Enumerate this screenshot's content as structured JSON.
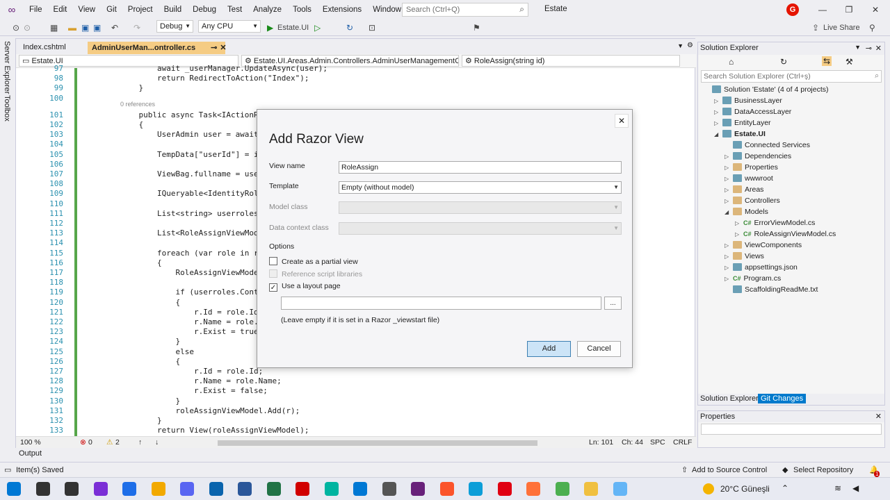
{
  "menu": {
    "items": [
      "File",
      "Edit",
      "View",
      "Git",
      "Project",
      "Build",
      "Debug",
      "Test",
      "Analyze",
      "Tools",
      "Extensions",
      "Window",
      "Help"
    ],
    "search_placeholder": "Search (Ctrl+Q)",
    "solution_name": "Estate",
    "account_initial": "G"
  },
  "toolbar": {
    "config": "Debug",
    "platform": "Any CPU",
    "startup": "Estate.UI",
    "live_share": "Live Share"
  },
  "side_tabs": {
    "server_explorer": "Server Explorer",
    "toolbox": "Toolbox"
  },
  "editor": {
    "tabs": [
      {
        "label": "Index.cshtml"
      },
      {
        "label": "AdminUserMan...ontroller.cs"
      }
    ],
    "nav": {
      "project": "Estate.UI",
      "class": "Estate.UI.Areas.Admin.Controllers.AdminUserManagementContro",
      "member": "RoleAssign(string id)"
    },
    "lines": [
      {
        "n": "97",
        "t": "        await _userManager.UpdateAsync(user);"
      },
      {
        "n": "98",
        "t": "        return RedirectToAction(\"Index\");"
      },
      {
        "n": "99",
        "t": "    }"
      },
      {
        "n": "100",
        "t": ""
      },
      {
        "n": "101",
        "t": "    public async Task<IActionResult"
      },
      {
        "n": "102",
        "t": "    {"
      },
      {
        "n": "103",
        "t": "        UserAdmin user = await _use"
      },
      {
        "n": "104",
        "t": ""
      },
      {
        "n": "105",
        "t": "        TempData[\"userId\"] = id;"
      },
      {
        "n": "106",
        "t": ""
      },
      {
        "n": "107",
        "t": "        ViewBag.fullname = user.Ful"
      },
      {
        "n": "108",
        "t": ""
      },
      {
        "n": "109",
        "t": "        IQueryable<IdentityRole> ro"
      },
      {
        "n": "110",
        "t": ""
      },
      {
        "n": "111",
        "t": "        List<string> userroles = aw"
      },
      {
        "n": "112",
        "t": ""
      },
      {
        "n": "113",
        "t": "        List<RoleAssignViewModel> r"
      },
      {
        "n": "114",
        "t": ""
      },
      {
        "n": "115",
        "t": "        foreach (var role in roles)"
      },
      {
        "n": "116",
        "t": "        {"
      },
      {
        "n": "117",
        "t": "            RoleAssignViewModel r ="
      },
      {
        "n": "118",
        "t": ""
      },
      {
        "n": "119",
        "t": "            if (userroles.Contains("
      },
      {
        "n": "120",
        "t": "            {"
      },
      {
        "n": "121",
        "t": "                r.Id = role.Id;"
      },
      {
        "n": "122",
        "t": "                r.Name = role.Name;"
      },
      {
        "n": "123",
        "t": "                r.Exist = true;"
      },
      {
        "n": "124",
        "t": "            }"
      },
      {
        "n": "125",
        "t": "            else"
      },
      {
        "n": "126",
        "t": "            {"
      },
      {
        "n": "127",
        "t": "                r.Id = role.Id;"
      },
      {
        "n": "128",
        "t": "                r.Name = role.Name;"
      },
      {
        "n": "129",
        "t": "                r.Exist = false;"
      },
      {
        "n": "130",
        "t": "            }"
      },
      {
        "n": "131",
        "t": "            roleAssignViewModel.Add(r);"
      },
      {
        "n": "132",
        "t": "        }"
      },
      {
        "n": "133",
        "t": "        return View(roleAssignViewModel);"
      }
    ],
    "references": "0 references",
    "status": {
      "zoom": "100 %",
      "errors": "0",
      "warnings": "2",
      "ln": "Ln: 101",
      "ch": "Ch: 44",
      "spc": "SPC",
      "crlf": "CRLF"
    }
  },
  "solution_explorer": {
    "title": "Solution Explorer",
    "search_placeholder": "Search Solution Explorer (Ctrl+ş)",
    "items": [
      {
        "label": "Solution 'Estate' (4 of 4 projects)",
        "indent": 0,
        "kind": "sln",
        "tw": ""
      },
      {
        "label": "BusinessLayer",
        "indent": 1,
        "kind": "proj",
        "tw": "▷"
      },
      {
        "label": "DataAccessLayer",
        "indent": 1,
        "kind": "proj",
        "tw": "▷"
      },
      {
        "label": "EntityLayer",
        "indent": 1,
        "kind": "proj",
        "tw": "▷"
      },
      {
        "label": "Estate.UI",
        "indent": 1,
        "kind": "proj",
        "tw": "◢",
        "bold": true
      },
      {
        "label": "Connected Services",
        "indent": 2,
        "kind": "svc",
        "tw": ""
      },
      {
        "label": "Dependencies",
        "indent": 2,
        "kind": "dep",
        "tw": "▷"
      },
      {
        "label": "Properties",
        "indent": 2,
        "kind": "prop",
        "tw": "▷"
      },
      {
        "label": "wwwroot",
        "indent": 2,
        "kind": "web",
        "tw": "▷"
      },
      {
        "label": "Areas",
        "indent": 2,
        "kind": "fold",
        "tw": "▷"
      },
      {
        "label": "Controllers",
        "indent": 2,
        "kind": "fold",
        "tw": "▷"
      },
      {
        "label": "Models",
        "indent": 2,
        "kind": "fold",
        "tw": "◢"
      },
      {
        "label": "ErrorViewModel.cs",
        "indent": 3,
        "kind": "cs",
        "tw": "▷"
      },
      {
        "label": "RoleAssignViewModel.cs",
        "indent": 3,
        "kind": "cs",
        "tw": "▷"
      },
      {
        "label": "ViewComponents",
        "indent": 2,
        "kind": "fold",
        "tw": "▷"
      },
      {
        "label": "Views",
        "indent": 2,
        "kind": "fold",
        "tw": "▷"
      },
      {
        "label": "appsettings.json",
        "indent": 2,
        "kind": "json",
        "tw": "▷"
      },
      {
        "label": "Program.cs",
        "indent": 2,
        "kind": "cs",
        "tw": "▷"
      },
      {
        "label": "ScaffoldingReadMe.txt",
        "indent": 2,
        "kind": "txt",
        "tw": ""
      }
    ],
    "bottom_tabs": [
      "Solution Explorer",
      "Git Changes"
    ]
  },
  "properties": {
    "title": "Properties"
  },
  "output_tab": "Output",
  "statusbar": {
    "left": "Item(s) Saved",
    "source_control": "Add to Source Control",
    "repo": "Select Repository",
    "notifications": "1"
  },
  "taskbar": {
    "weather": "20°C Güneşli",
    "icons": [
      "windows-start-icon",
      "search-icon",
      "task-view-icon",
      "app-purple-icon",
      "app-c-icon",
      "app-photo-icon",
      "discord-icon",
      "outlook-icon",
      "word-icon",
      "excel-icon",
      "record-icon",
      "app-bolt-icon",
      "vscode-icon",
      "tool-icon",
      "visual-studio-icon",
      "brave-icon",
      "edge-icon",
      "opera-icon",
      "firefox-icon",
      "chrome-icon",
      "file-explorer-icon",
      "notes-icon"
    ],
    "icon_colors": [
      "#0078d4",
      "#333",
      "#333",
      "#7b2fd6",
      "#1e6ee8",
      "#f2a900",
      "#5865f2",
      "#0a64ad",
      "#2b579a",
      "#217346",
      "#d10000",
      "#00b4a0",
      "#0078d4",
      "#555",
      "#68217a",
      "#fb542b",
      "#0c9ed8",
      "#e00012",
      "#ff7139",
      "#4caf50",
      "#f0c040",
      "#64b5f6"
    ]
  },
  "dialog": {
    "title": "Add Razor View",
    "view_name_label": "View name",
    "view_name": "RoleAssign",
    "template_label": "Template",
    "template": "Empty (without model)",
    "model_class_label": "Model class",
    "data_context_label": "Data context class",
    "options_label": "Options",
    "partial_label": "Create as a partial view",
    "partial_checked": false,
    "scripts_label": "Reference script libraries",
    "layout_label": "Use a layout page",
    "layout_checked": true,
    "layout_value": "",
    "browse_label": "...",
    "hint": "(Leave empty if it is set in a Razor _viewstart file)",
    "add_label": "Add",
    "cancel_label": "Cancel"
  }
}
